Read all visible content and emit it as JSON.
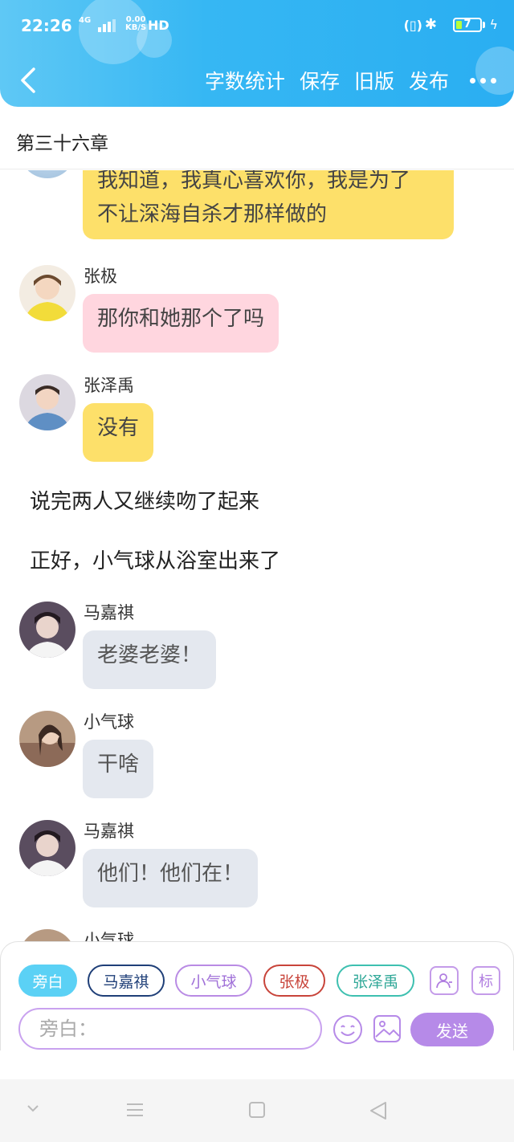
{
  "status_bar": {
    "time": "22:26",
    "network": "4G",
    "speed_value": "0.00",
    "speed_unit": "KB/S",
    "hd": "HD",
    "battery": "7"
  },
  "toolbar": {
    "word_count": "字数统计",
    "save": "保存",
    "old_version": "旧版",
    "publish": "发布"
  },
  "chapter": {
    "title": "第三十六章"
  },
  "messages": [
    {
      "text_line1": "我知道，我真心喜欢你，我是为了",
      "text_line2": "不让深海自杀才那样做的"
    },
    {
      "name": "张极",
      "text": "那你和她那个了吗"
    },
    {
      "name": "张泽禹",
      "text": "没有"
    },
    {
      "narration": "说完两人又继续吻了起来"
    },
    {
      "narration": "正好，小气球从浴室出来了"
    },
    {
      "name": "马嘉祺",
      "text": "老婆老婆！"
    },
    {
      "name": "小气球",
      "text": "干啥"
    },
    {
      "name": "马嘉祺",
      "text": "他们！他们在！"
    },
    {
      "name": "小气球"
    }
  ],
  "characters": [
    {
      "label": "旁白",
      "color": "#5bd1f5"
    },
    {
      "label": "马嘉祺",
      "color": "#1f3f78"
    },
    {
      "label": "小气球",
      "color": "#b98be4"
    },
    {
      "label": "张极",
      "color": "#c8443a"
    },
    {
      "label": "张泽禹",
      "color": "#3ec0b0"
    }
  ],
  "side_buttons": {
    "mark": "标"
  },
  "input": {
    "placeholder": "旁白："
  },
  "send": {
    "label": "发送"
  },
  "colors": {
    "header": "#36b7f3",
    "yellow_bubble": "#fde06a",
    "pink_bubble": "#ffd6df",
    "gray_bubble": "#e4e8ef",
    "send": "#b68ae8"
  }
}
